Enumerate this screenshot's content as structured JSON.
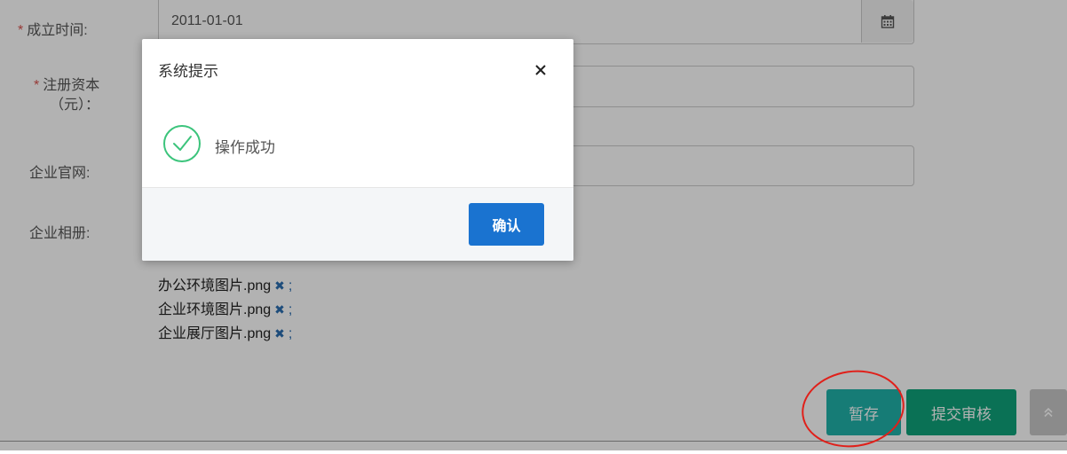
{
  "form": {
    "founded_label": "成立时间:",
    "founded_value": "2011-01-01",
    "capital_label_line1": "注册资本",
    "capital_label_line2": "（元）：",
    "website_label": "企业官网:",
    "album_label": "企业相册:",
    "required_mark": "*",
    "files": [
      {
        "name": "办公环境图片.png",
        "sep": ";"
      },
      {
        "name": "企业环境图片.png",
        "sep": ";"
      },
      {
        "name": "企业展厅图片.png",
        "sep": ";"
      }
    ],
    "calendar_icon": "calendar-icon",
    "remove_icon": "remove-icon"
  },
  "actions": {
    "save_label": "暂存",
    "submit_label": "提交审核",
    "back_to_top_icon": "double-chevron-up-icon"
  },
  "dialog": {
    "title": "系统提示",
    "message": "操作成功",
    "ok_label": "确认",
    "close_icon": "close-icon",
    "success_icon": "check-circle-icon"
  },
  "colors": {
    "save_button": "#20b2aa",
    "submit_button": "#0fa37a",
    "ok_button": "#1a73d0",
    "success_green": "#3cc47c",
    "required": "#d9534f",
    "annotation": "#e0201a"
  }
}
